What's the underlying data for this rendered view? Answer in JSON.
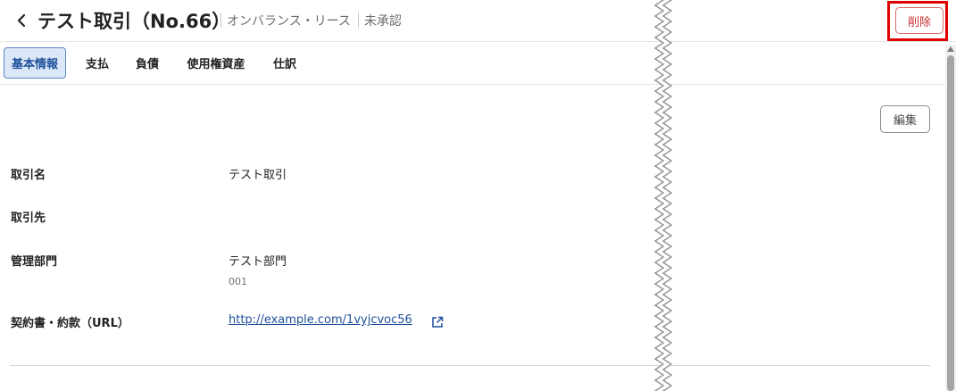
{
  "header": {
    "title": "テスト取引（No.66）",
    "category": "オンバランス・リース",
    "status": "未承認",
    "delete_label": "削除"
  },
  "tabs": [
    {
      "label": "基本情報",
      "active": true
    },
    {
      "label": "支払",
      "active": false
    },
    {
      "label": "負債",
      "active": false
    },
    {
      "label": "使用権資産",
      "active": false
    },
    {
      "label": "仕訳",
      "active": false
    }
  ],
  "edit_label": "編集",
  "fields": [
    {
      "label": "取引名",
      "value": "テスト取引"
    },
    {
      "label": "取引先",
      "value": ""
    },
    {
      "label": "管理部門",
      "value": "テスト部門",
      "sub": "001"
    },
    {
      "label": "契約書・約款（URL）",
      "link": "http://example.com/1vyjcvoc56"
    }
  ],
  "icons": {
    "back": "chevron-left-icon",
    "external": "external-link-icon",
    "scroll_up": "triangle-up-icon"
  },
  "colors": {
    "accent": "#1d4f9a",
    "active_tab_bg": "#dce8f8",
    "delete": "#c83232",
    "highlight": "#e00000"
  }
}
